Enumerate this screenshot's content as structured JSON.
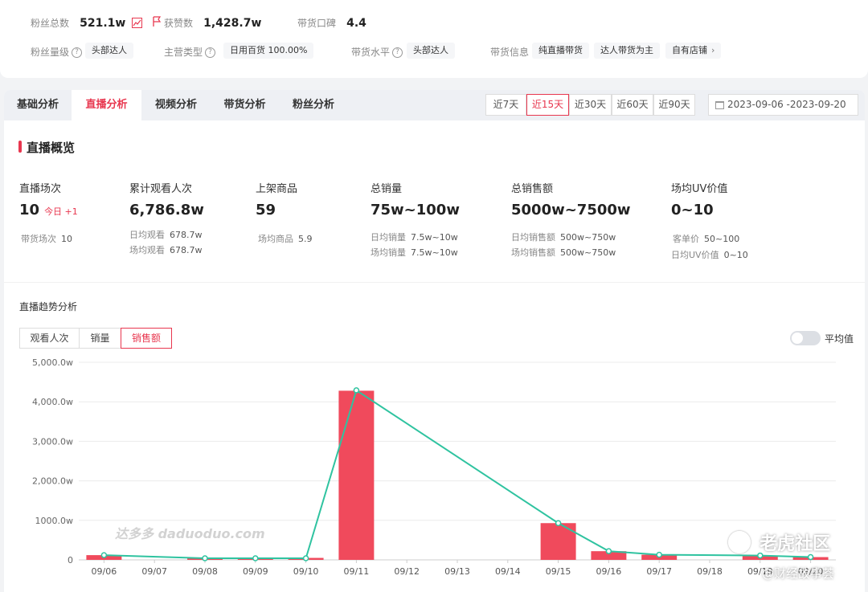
{
  "profile": {
    "fans_label": "粉丝总数",
    "fans_value": "521.1w",
    "likes_label": "获赞数",
    "likes_value": "1,428.7w",
    "reputation_label": "带货口碑",
    "reputation_value": "4.4",
    "fans_level_label": "粉丝量级",
    "fans_level_tag": "头部达人",
    "main_type_label": "主营类型",
    "main_type_tag": "日用百货 100.00%",
    "sales_level_label": "带货水平",
    "sales_level_tag": "头部达人",
    "sales_info_label": "带货信息",
    "sales_info_tags": [
      "纯直播带货",
      "达人带货为主",
      "自有店铺"
    ]
  },
  "tabs": [
    "基础分析",
    "直播分析",
    "视频分析",
    "带货分析",
    "粉丝分析"
  ],
  "active_tab": 1,
  "ranges": [
    "近7天",
    "近15天",
    "近30天",
    "近60天",
    "近90天"
  ],
  "active_range": 1,
  "date_range": "2023-09-06 -2023-09-20",
  "overview": {
    "title": "直播概览",
    "metrics": [
      {
        "title": "直播场次",
        "value": "10",
        "extra": "今日 +1",
        "subs": [
          [
            "带货场次",
            "10"
          ]
        ]
      },
      {
        "title": "累计观看人次",
        "value": "6,786.8w",
        "subs": [
          [
            "日均观看",
            "678.7w"
          ],
          [
            "场均观看",
            "678.7w"
          ]
        ]
      },
      {
        "title": "上架商品",
        "value": "59",
        "subs": [
          [
            "场均商品",
            "5.9"
          ]
        ]
      },
      {
        "title": "总销量",
        "value": "75w~100w",
        "subs": [
          [
            "日均销量",
            "7.5w~10w"
          ],
          [
            "场均销量",
            "7.5w~10w"
          ]
        ]
      },
      {
        "title": "总销售额",
        "value": "5000w~7500w",
        "subs": [
          [
            "日均销售额",
            "500w~750w"
          ],
          [
            "场均销售额",
            "500w~750w"
          ]
        ]
      },
      {
        "title": "场均UV价值",
        "value": "0~10",
        "subs": [
          [
            "客单价",
            "50~100"
          ],
          [
            "日均UV价值",
            "0~10"
          ]
        ]
      }
    ]
  },
  "trend": {
    "title": "直播趋势分析",
    "metric_tabs": [
      "观看人次",
      "销量",
      "销售额"
    ],
    "active_metric": 2,
    "avg_toggle_label": "平均值",
    "watermark": "达多多 daduoduo.com",
    "corner_watermark": "老虎社区",
    "corner_watermark_sub": "@财经故事荟"
  },
  "colors": {
    "accent": "#e8374f",
    "bar": "#f04a5c",
    "line": "#2fc3a0"
  },
  "chart_data": {
    "type": "bar",
    "categories": [
      "09/06",
      "09/07",
      "09/08",
      "09/09",
      "09/10",
      "09/11",
      "09/12",
      "09/13",
      "09/14",
      "09/15",
      "09/16",
      "09/17",
      "09/18",
      "09/19",
      "09/20"
    ],
    "y_tick_labels": [
      "0",
      "1000.0w",
      "2,000.0w",
      "3,000.0w",
      "4,000.0w",
      "5,000.0w"
    ],
    "ylim": [
      0,
      5000
    ],
    "series": [
      {
        "kind": "bar",
        "values": [
          120,
          0,
          50,
          50,
          50,
          4280,
          0,
          0,
          0,
          930,
          220,
          130,
          0,
          110,
          70
        ]
      },
      {
        "kind": "line",
        "values": [
          120,
          null,
          40,
          40,
          40,
          4290,
          null,
          null,
          null,
          930,
          220,
          130,
          null,
          110,
          70
        ]
      }
    ],
    "grid": true
  }
}
